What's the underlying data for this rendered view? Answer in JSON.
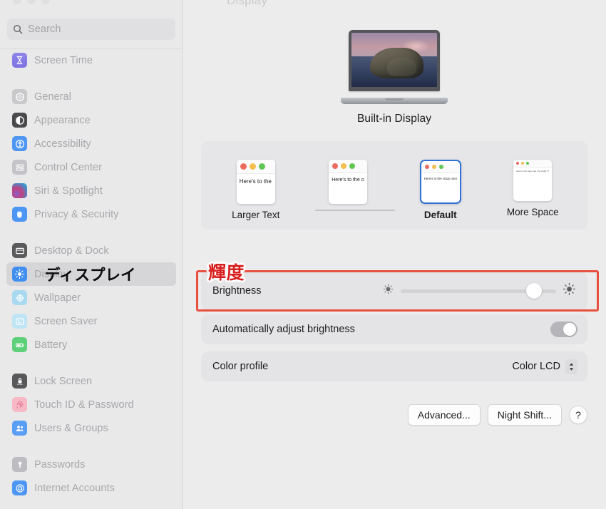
{
  "window": {
    "search": {
      "placeholder": "Search",
      "icon": "search-icon"
    }
  },
  "sidebar": {
    "groups": [
      {
        "items": [
          {
            "label": "Screen Time",
            "icon": "hourglass-icon",
            "icon_class": "ic-screentime"
          }
        ]
      },
      {
        "items": [
          {
            "label": "General",
            "icon": "gear-icon",
            "icon_class": "ic-general"
          },
          {
            "label": "Appearance",
            "icon": "contrast-circle-icon",
            "icon_class": "ic-appearance"
          },
          {
            "label": "Accessibility",
            "icon": "accessibility-person-icon",
            "icon_class": "ic-access"
          },
          {
            "label": "Control Center",
            "icon": "sliders-icon",
            "icon_class": "ic-control"
          },
          {
            "label": "Siri & Spotlight",
            "icon": "siri-orb-icon",
            "icon_class": "ic-siri"
          },
          {
            "label": "Privacy & Security",
            "icon": "hand-raised-icon",
            "icon_class": "ic-privacy"
          }
        ]
      },
      {
        "items": [
          {
            "label": "Desktop & Dock",
            "icon": "window-icon",
            "icon_class": "ic-desktop"
          },
          {
            "label": "Display",
            "icon": "brightness-sun-icon",
            "icon_class": "ic-display",
            "selected": true
          },
          {
            "label": "Wallpaper",
            "icon": "flower-icon",
            "icon_class": "ic-wallpaper"
          },
          {
            "label": "Screen Saver",
            "icon": "screensaver-icon",
            "icon_class": "ic-saver"
          },
          {
            "label": "Battery",
            "icon": "battery-icon",
            "icon_class": "ic-battery"
          }
        ]
      },
      {
        "items": [
          {
            "label": "Lock Screen",
            "icon": "lock-icon",
            "icon_class": "ic-lock"
          },
          {
            "label": "Touch ID & Password",
            "icon": "fingerprint-icon",
            "icon_class": "ic-touchid"
          },
          {
            "label": "Users & Groups",
            "icon": "users-icon",
            "icon_class": "ic-users"
          }
        ]
      },
      {
        "items": [
          {
            "label": "Passwords",
            "icon": "key-icon",
            "icon_class": "ic-passwords"
          },
          {
            "label": "Internet Accounts",
            "icon": "at-sign-icon",
            "icon_class": "ic-internet"
          }
        ]
      }
    ]
  },
  "annotations": {
    "sidebar_display_jp": "ディスプレイ",
    "brightness_jp": "輝度",
    "box_color": "#e8503f",
    "text_color": "#d81f1f"
  },
  "main": {
    "header_ghost": "Display",
    "display_name": "Built-in Display",
    "resolution": {
      "options": [
        {
          "caption": "Larger Text",
          "selected": false,
          "preview_text": "Here's to the crazy ones. The misfits. The rebels. The troublemakers."
        },
        {
          "caption": "",
          "selected": false,
          "preview_text": "Here's to the crazy ones. The misfits. The rebels. The troublemakers. The round pegs in the square holes. The ones who see things differently."
        },
        {
          "caption": "Default",
          "selected": true,
          "preview_text": "Here's to the crazy ones. The misfits. The rebels. The troublemakers. The round pegs in the square holes. The ones who see things differently. They're not fond of rules. And they have no respect for the status quo."
        },
        {
          "caption": "More Space",
          "selected": false,
          "preview_text": "Here's to the crazy ones. The misfits. The rebels. The troublemakers. The round pegs in the square holes. The ones who see things differently. They're not fond of rules. And they have no respect for the status quo. You can quote them, disagree with them, glorify or vilify them. About the only thing you can't do is ignore them. Because they change things."
        }
      ]
    },
    "brightness": {
      "label": "Brightness",
      "value_percent": 86,
      "min_icon": "brightness-low-icon",
      "max_icon": "brightness-high-icon"
    },
    "auto_brightness": {
      "label": "Automatically adjust brightness",
      "enabled": true
    },
    "color_profile": {
      "label": "Color profile",
      "value": "Color LCD",
      "chevron_icon": "chevron-up-down-icon"
    },
    "buttons": {
      "advanced": "Advanced...",
      "night_shift": "Night Shift...",
      "help": "?"
    }
  }
}
